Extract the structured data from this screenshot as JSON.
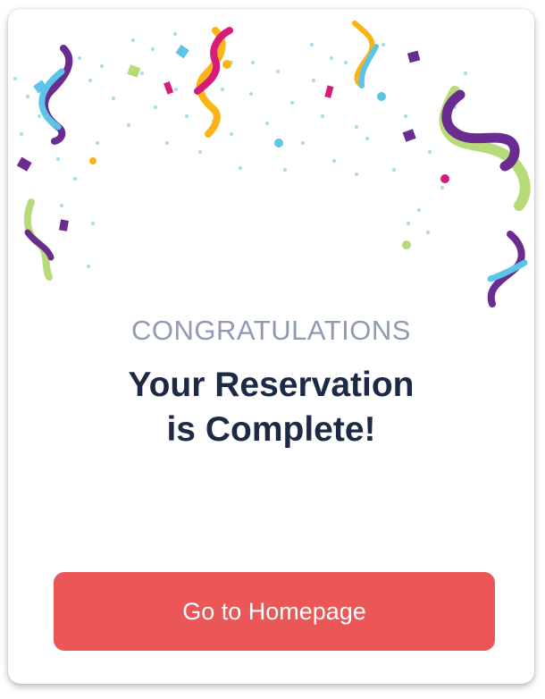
{
  "dialog": {
    "eyebrow": "CONGRATULATIONS",
    "headline_line1": "Your Reservation",
    "headline_line2": "is Complete!",
    "button_label": "Go to Homepage"
  },
  "colors": {
    "button": "#eb5757",
    "eyebrow": "#8f9bb3",
    "headline": "#1d2a45",
    "confetti": [
      "#6a2c91",
      "#5bc4e8",
      "#fbb416",
      "#d81b7a",
      "#b8db7a"
    ]
  }
}
